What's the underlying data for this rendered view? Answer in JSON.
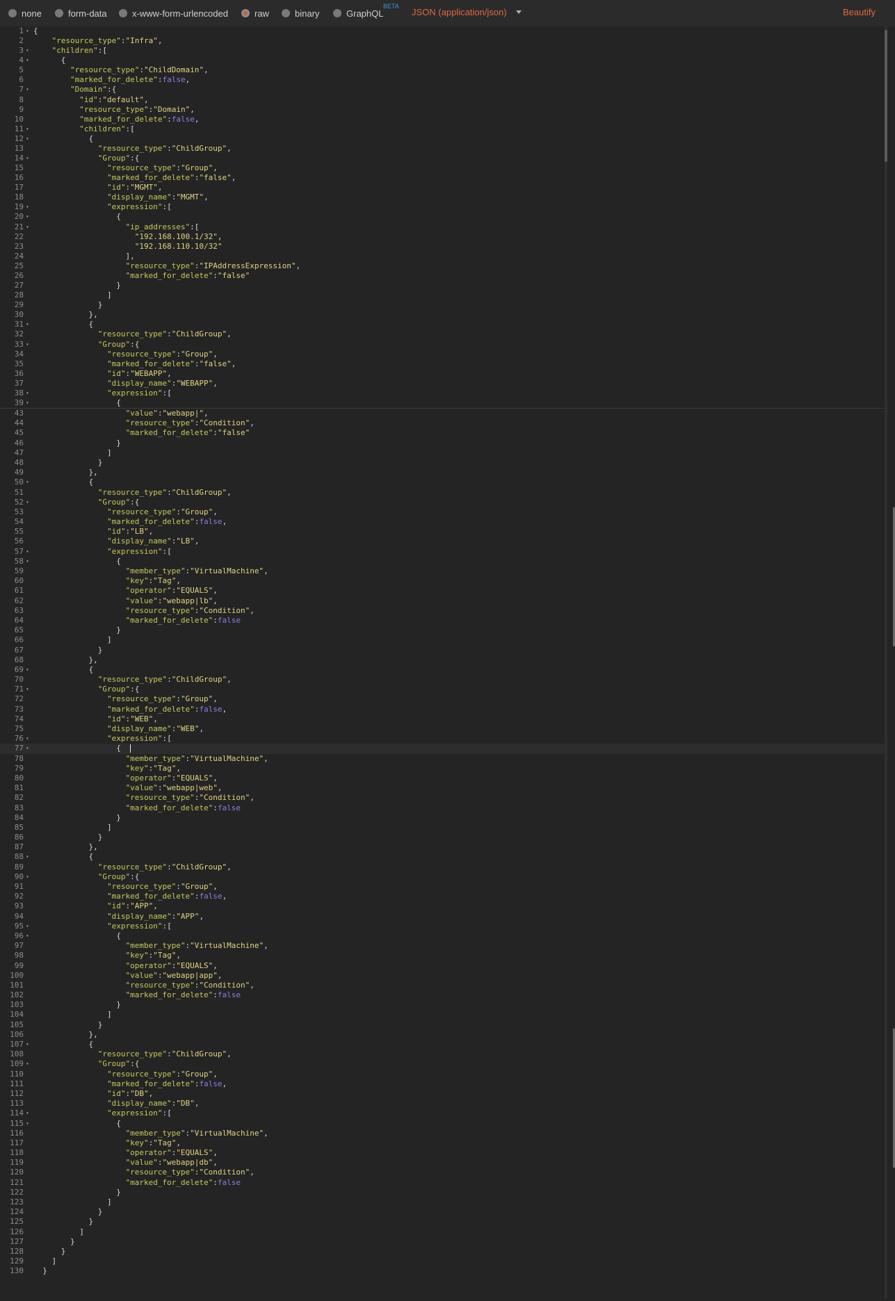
{
  "body_modes": [
    {
      "label": "none",
      "selected": false
    },
    {
      "label": "form-data",
      "selected": false
    },
    {
      "label": "x-www-form-urlencoded",
      "selected": false
    },
    {
      "label": "raw",
      "selected": true
    },
    {
      "label": "binary",
      "selected": false
    },
    {
      "label": "GraphQL",
      "selected": false,
      "badge": "BETA"
    }
  ],
  "content_type": "JSON (application/json)",
  "beautify_label": "Beautify",
  "colors": {
    "accent": "#e3683f",
    "key": "#c7c95a",
    "string": "#e2d480",
    "boolean": "#8d7ce6",
    "beta": "#3f8fe0",
    "background": "#242424"
  },
  "editor": {
    "cursor_line": 77,
    "fold_lines": [
      1,
      3,
      4,
      7,
      11,
      12,
      14,
      19,
      20,
      21,
      31,
      33,
      38,
      39,
      50,
      52,
      57,
      58,
      69,
      71,
      76,
      77,
      88,
      90,
      95,
      96,
      107,
      109,
      114,
      115
    ],
    "segments": [
      {
        "lines": [
          {
            "n": 1,
            "text": "{"
          },
          {
            "n": 2,
            "text": "    \"resource_type\":\"Infra\","
          },
          {
            "n": 3,
            "text": "    \"children\":["
          },
          {
            "n": 4,
            "text": "      {"
          },
          {
            "n": 5,
            "text": "        \"resource_type\":\"ChildDomain\","
          },
          {
            "n": 6,
            "text": "        \"marked_for_delete\":false,"
          },
          {
            "n": 7,
            "text": "        \"Domain\":{"
          },
          {
            "n": 8,
            "text": "          \"id\":\"default\","
          },
          {
            "n": 9,
            "text": "          \"resource_type\":\"Domain\","
          },
          {
            "n": 10,
            "text": "          \"marked_for_delete\":false,"
          },
          {
            "n": 11,
            "text": "          \"children\":["
          },
          {
            "n": 12,
            "text": "            {"
          },
          {
            "n": 13,
            "text": "              \"resource_type\":\"ChildGroup\","
          },
          {
            "n": 14,
            "text": "              \"Group\":{"
          },
          {
            "n": 15,
            "text": "                \"resource_type\":\"Group\","
          },
          {
            "n": 16,
            "text": "                \"marked_for_delete\":\"false\","
          },
          {
            "n": 17,
            "text": "                \"id\":\"MGMT\","
          },
          {
            "n": 18,
            "text": "                \"display_name\":\"MGMT\","
          },
          {
            "n": 19,
            "text": "                \"expression\":["
          },
          {
            "n": 20,
            "text": "                  {"
          },
          {
            "n": 21,
            "text": "                    \"ip_addresses\":["
          },
          {
            "n": 22,
            "text": "                      \"192.168.100.1/32\","
          },
          {
            "n": 23,
            "text": "                      \"192.168.110.10/32\""
          },
          {
            "n": 24,
            "text": "                    ],"
          },
          {
            "n": 25,
            "text": "                    \"resource_type\":\"IPAddressExpression\","
          },
          {
            "n": 26,
            "text": "                    \"marked_for_delete\":\"false\""
          },
          {
            "n": 27,
            "text": "                  }"
          },
          {
            "n": 28,
            "text": "                ]"
          },
          {
            "n": 29,
            "text": "              }"
          },
          {
            "n": 30,
            "text": "            },"
          },
          {
            "n": 31,
            "text": "            {"
          },
          {
            "n": 32,
            "text": "              \"resource_type\":\"ChildGroup\","
          },
          {
            "n": 33,
            "text": "              \"Group\":{"
          },
          {
            "n": 34,
            "text": "                \"resource_type\":\"Group\","
          },
          {
            "n": 35,
            "text": "                \"marked_for_delete\":\"false\","
          },
          {
            "n": 36,
            "text": "                \"id\":\"WEBAPP\","
          },
          {
            "n": 37,
            "text": "                \"display_name\":\"WEBAPP\","
          },
          {
            "n": 38,
            "text": "                \"expression\":["
          },
          {
            "n": 39,
            "text": "                  {"
          }
        ]
      },
      {
        "lines": [
          {
            "n": 43,
            "text": "                    \"value\":\"webapp|\","
          },
          {
            "n": 44,
            "text": "                    \"resource_type\":\"Condition\","
          },
          {
            "n": 45,
            "text": "                    \"marked_for_delete\":\"false\""
          },
          {
            "n": 46,
            "text": "                  }"
          },
          {
            "n": 47,
            "text": "                ]"
          },
          {
            "n": 48,
            "text": "              }"
          },
          {
            "n": 49,
            "text": "            },"
          },
          {
            "n": 50,
            "text": "            {"
          },
          {
            "n": 51,
            "text": "              \"resource_type\":\"ChildGroup\","
          },
          {
            "n": 52,
            "text": "              \"Group\":{"
          },
          {
            "n": 53,
            "text": "                \"resource_type\":\"Group\","
          },
          {
            "n": 54,
            "text": "                \"marked_for_delete\":false,"
          },
          {
            "n": 55,
            "text": "                \"id\":\"LB\","
          },
          {
            "n": 56,
            "text": "                \"display_name\":\"LB\","
          },
          {
            "n": 57,
            "text": "                \"expression\":["
          },
          {
            "n": 58,
            "text": "                  {"
          },
          {
            "n": 59,
            "text": "                    \"member_type\":\"VirtualMachine\","
          },
          {
            "n": 60,
            "text": "                    \"key\":\"Tag\","
          },
          {
            "n": 61,
            "text": "                    \"operator\":\"EQUALS\","
          },
          {
            "n": 62,
            "text": "                    \"value\":\"webapp|lb\","
          },
          {
            "n": 63,
            "text": "                    \"resource_type\":\"Condition\","
          },
          {
            "n": 64,
            "text": "                    \"marked_for_delete\":false"
          },
          {
            "n": 65,
            "text": "                  }"
          },
          {
            "n": 66,
            "text": "                ]"
          },
          {
            "n": 67,
            "text": "              }"
          },
          {
            "n": 68,
            "text": "            },"
          },
          {
            "n": 69,
            "text": "            {"
          },
          {
            "n": 70,
            "text": "              \"resource_type\":\"ChildGroup\","
          },
          {
            "n": 71,
            "text": "              \"Group\":{"
          },
          {
            "n": 72,
            "text": "                \"resource_type\":\"Group\","
          },
          {
            "n": 73,
            "text": "                \"marked_for_delete\":false,"
          },
          {
            "n": 74,
            "text": "                \"id\":\"WEB\","
          },
          {
            "n": 75,
            "text": "                \"display_name\":\"WEB\","
          },
          {
            "n": 76,
            "text": "                \"expression\":["
          },
          {
            "n": 77,
            "text": "                  {  "
          },
          {
            "n": 78,
            "text": "                    \"member_type\":\"VirtualMachine\","
          },
          {
            "n": 79,
            "text": "                    \"key\":\"Tag\","
          },
          {
            "n": 80,
            "text": "                    \"operator\":\"EQUALS\","
          },
          {
            "n": 81,
            "text": "                    \"value\":\"webapp|web\","
          },
          {
            "n": 82,
            "text": "                    \"resource_type\":\"Condition\","
          },
          {
            "n": 83,
            "text": "                    \"marked_for_delete\":false"
          },
          {
            "n": 84,
            "text": "                  }"
          },
          {
            "n": 85,
            "text": "                ]"
          },
          {
            "n": 86,
            "text": "              }"
          },
          {
            "n": 87,
            "text": "            },"
          },
          {
            "n": 88,
            "text": "            {"
          },
          {
            "n": 89,
            "text": "              \"resource_type\":\"ChildGroup\","
          },
          {
            "n": 90,
            "text": "              \"Group\":{"
          },
          {
            "n": 91,
            "text": "                \"resource_type\":\"Group\","
          },
          {
            "n": 92,
            "text": "                \"marked_for_delete\":false,"
          },
          {
            "n": 93,
            "text": "                \"id\":\"APP\","
          },
          {
            "n": 94,
            "text": "                \"display_name\":\"APP\","
          },
          {
            "n": 95,
            "text": "                \"expression\":["
          },
          {
            "n": 96,
            "text": "                  {"
          },
          {
            "n": 97,
            "text": "                    \"member_type\":\"VirtualMachine\","
          },
          {
            "n": 98,
            "text": "                    \"key\":\"Tag\","
          },
          {
            "n": 99,
            "text": "                    \"operator\":\"EQUALS\","
          },
          {
            "n": 100,
            "text": "                    \"value\":\"webapp|app\","
          },
          {
            "n": 101,
            "text": "                    \"resource_type\":\"Condition\","
          },
          {
            "n": 102,
            "text": "                    \"marked_for_delete\":false"
          },
          {
            "n": 103,
            "text": "                  }"
          },
          {
            "n": 104,
            "text": "                ]"
          },
          {
            "n": 105,
            "text": "              }"
          },
          {
            "n": 106,
            "text": "            },"
          },
          {
            "n": 107,
            "text": "            {"
          },
          {
            "n": 108,
            "text": "              \"resource_type\":\"ChildGroup\","
          },
          {
            "n": 109,
            "text": "              \"Group\":{"
          },
          {
            "n": 110,
            "text": "                \"resource_type\":\"Group\","
          },
          {
            "n": 111,
            "text": "                \"marked_for_delete\":false,"
          },
          {
            "n": 112,
            "text": "                \"id\":\"DB\","
          },
          {
            "n": 113,
            "text": "                \"display_name\":\"DB\","
          },
          {
            "n": 114,
            "text": "                \"expression\":["
          },
          {
            "n": 115,
            "text": "                  {"
          },
          {
            "n": 116,
            "text": "                    \"member_type\":\"VirtualMachine\","
          },
          {
            "n": 117,
            "text": "                    \"key\":\"Tag\","
          },
          {
            "n": 118,
            "text": "                    \"operator\":\"EQUALS\","
          },
          {
            "n": 119,
            "text": "                    \"value\":\"webapp|db\","
          },
          {
            "n": 120,
            "text": "                    \"resource_type\":\"Condition\","
          },
          {
            "n": 121,
            "text": "                    \"marked_for_delete\":false"
          },
          {
            "n": 122,
            "text": "                  }"
          },
          {
            "n": 123,
            "text": "                ]"
          },
          {
            "n": 124,
            "text": "              }"
          },
          {
            "n": 125,
            "text": "            }"
          },
          {
            "n": 126,
            "text": "          ]"
          },
          {
            "n": 127,
            "text": "        }"
          },
          {
            "n": 128,
            "text": "      }"
          },
          {
            "n": 129,
            "text": "    ]"
          },
          {
            "n": 130,
            "text": "  }"
          }
        ]
      }
    ]
  }
}
